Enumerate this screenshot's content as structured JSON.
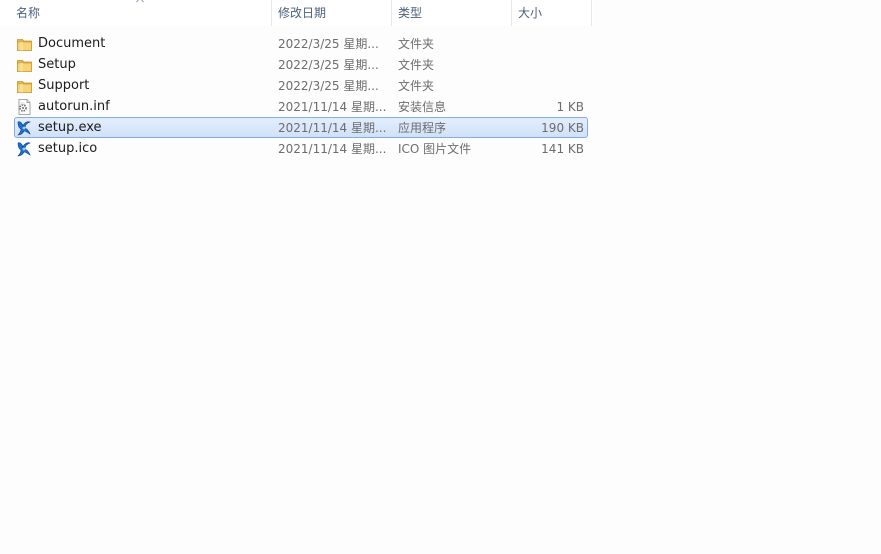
{
  "columns": {
    "name": "名称",
    "date": "修改日期",
    "type": "类型",
    "size": "大小"
  },
  "files": [
    {
      "name": "Document",
      "date": "2022/3/25 星期...",
      "type": "文件夹",
      "size": "",
      "icon": "folder-icon",
      "selected": false
    },
    {
      "name": "Setup",
      "date": "2022/3/25 星期...",
      "type": "文件夹",
      "size": "",
      "icon": "folder-icon",
      "selected": false
    },
    {
      "name": "Support",
      "date": "2022/3/25 星期...",
      "type": "文件夹",
      "size": "",
      "icon": "folder-icon",
      "selected": false
    },
    {
      "name": "autorun.inf",
      "date": "2021/11/14 星期...",
      "type": "安装信息",
      "size": "1 KB",
      "icon": "settings-file-icon",
      "selected": false
    },
    {
      "name": "setup.exe",
      "date": "2021/11/14 星期...",
      "type": "应用程序",
      "size": "190 KB",
      "icon": "setup-app-icon",
      "selected": true
    },
    {
      "name": "setup.ico",
      "date": "2021/11/14 星期...",
      "type": "ICO 图片文件",
      "size": "141 KB",
      "icon": "setup-app-icon",
      "selected": false
    }
  ],
  "colors": {
    "selection_border": "#84acdd",
    "selection_fill": "#d9e8fb",
    "header_text": "#4c607a",
    "secondary_text": "#6d6d6d"
  }
}
